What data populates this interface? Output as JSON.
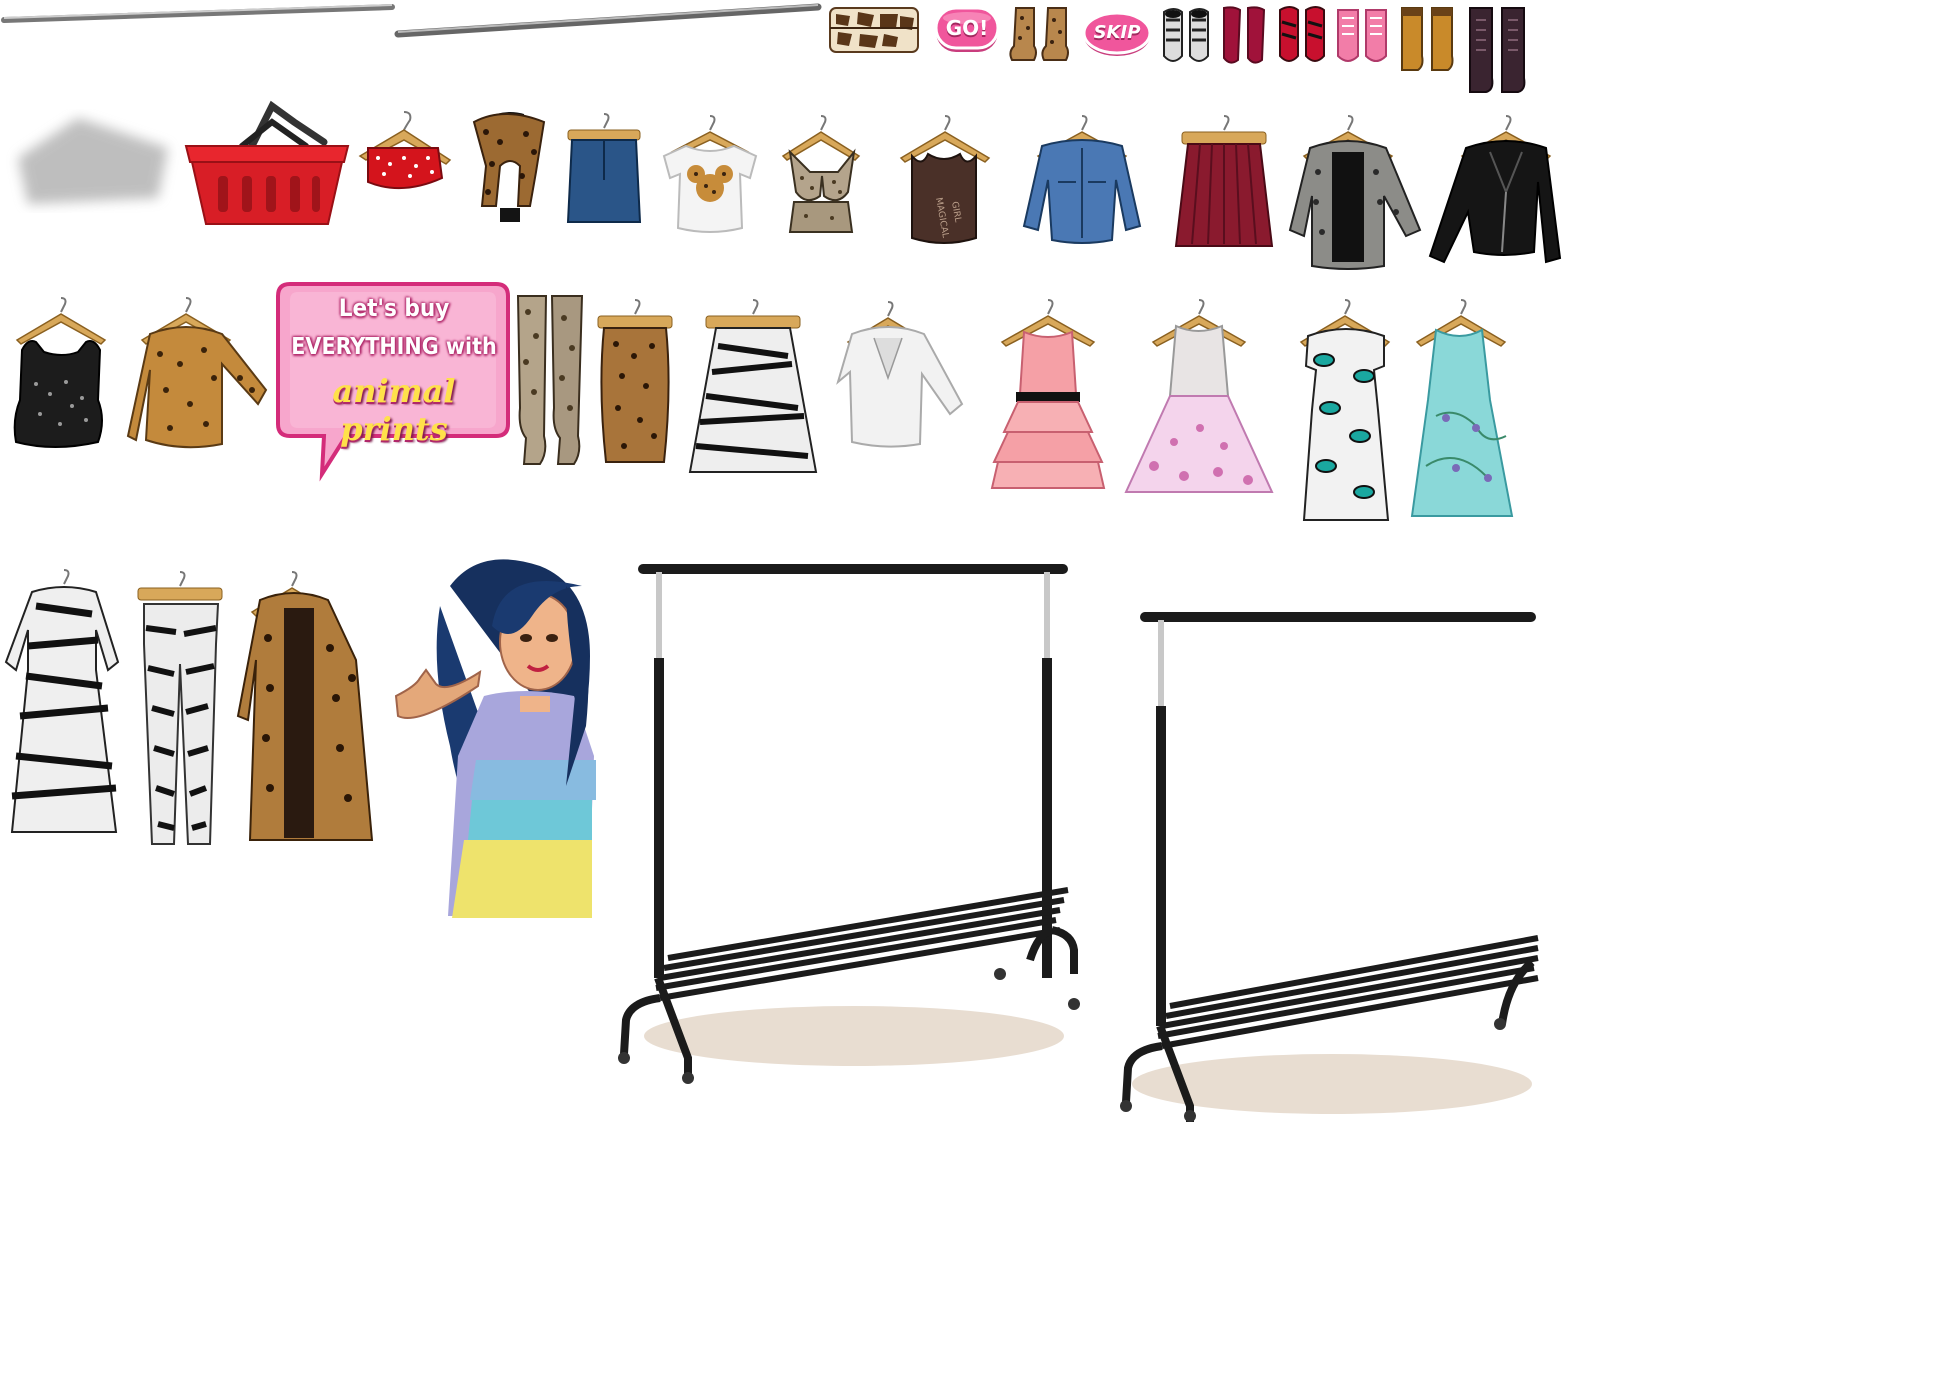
{
  "buttons": {
    "go_label": "GO!",
    "skip_label": "SKIP"
  },
  "speech_bubble": {
    "line1": "Let's buy",
    "line2": "EVERYTHING with",
    "line3": "animal prints"
  },
  "colors": {
    "button_pink": "#f0569c",
    "bubble_pink": "#f7a6cc",
    "bubble_border": "#d42c7a",
    "basket_red": "#e8262e",
    "rack_black": "#1b1b1b",
    "hanger_wood": "#d8a85a"
  },
  "sprites": [
    "rod-short",
    "rod-long",
    "giraffe-clutch",
    "go-button",
    "leopard-boots",
    "skip-button",
    "zebra-flats",
    "burgundy-heels",
    "red-zebra-flats",
    "pink-sneakers",
    "tan-work-boots",
    "plum-combat-boots",
    "shop-shadow",
    "shopping-basket",
    "red-polka-crop-top",
    "leopard-scarf",
    "denim-skirt",
    "mouse-print-tee",
    "snake-bralette",
    "brown-tank-top",
    "denim-jacket",
    "burgundy-pleated-skirt",
    "snakeskin-blazer",
    "black-leather-jacket",
    "sequin-camisole",
    "leopard-sweater",
    "speech-bubble",
    "snakeskin-over-knee-boots",
    "leopard-pencil-skirt",
    "zebra-midi-skirt",
    "white-blazer",
    "pink-ruffle-dress",
    "floral-tulle-dress",
    "leopard-print-dress",
    "mint-floral-dress",
    "zebra-maxi-dress",
    "zebra-pants",
    "leopard-coat",
    "girl-character",
    "clothing-rack-large",
    "clothing-rack-small"
  ]
}
